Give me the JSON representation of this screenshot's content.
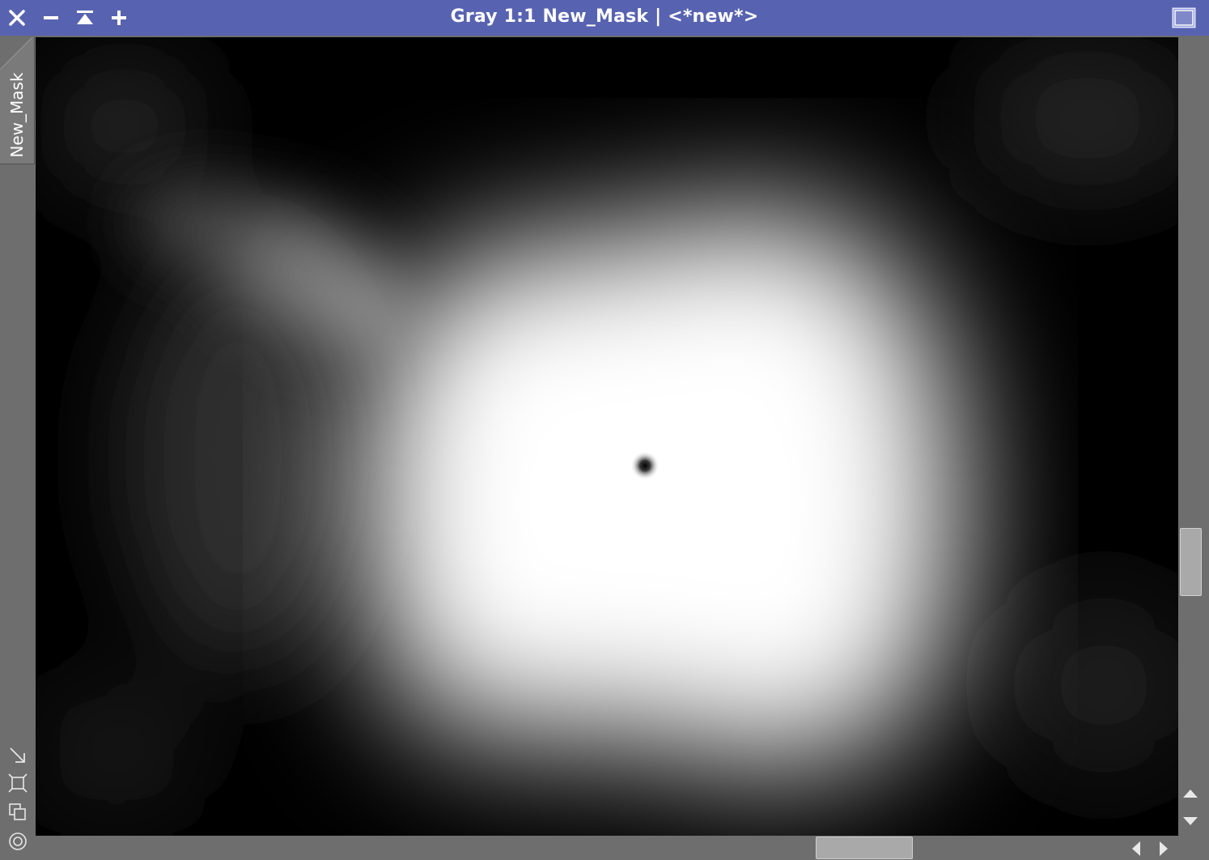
{
  "window": {
    "title": "Gray 1:1 New_Mask | <*new*>",
    "titlebar_color": "#5763b0",
    "controls": [
      "close-icon",
      "minimize-icon",
      "shade-icon",
      "maximize-icon",
      "restore-window-icon"
    ]
  },
  "sidebar": {
    "tab_label": "New_Mask",
    "tools": [
      "zoom-to-fit-icon",
      "fit-window-icon",
      "clone-view-icon",
      "target-icon"
    ]
  },
  "image": {
    "mode": "grayscale",
    "content": "mask"
  },
  "scrollbars": {
    "vertical": [
      "scroll-up-icon",
      "scroll-down-icon"
    ],
    "horizontal": [
      "scroll-left-icon",
      "scroll-right-icon"
    ]
  }
}
